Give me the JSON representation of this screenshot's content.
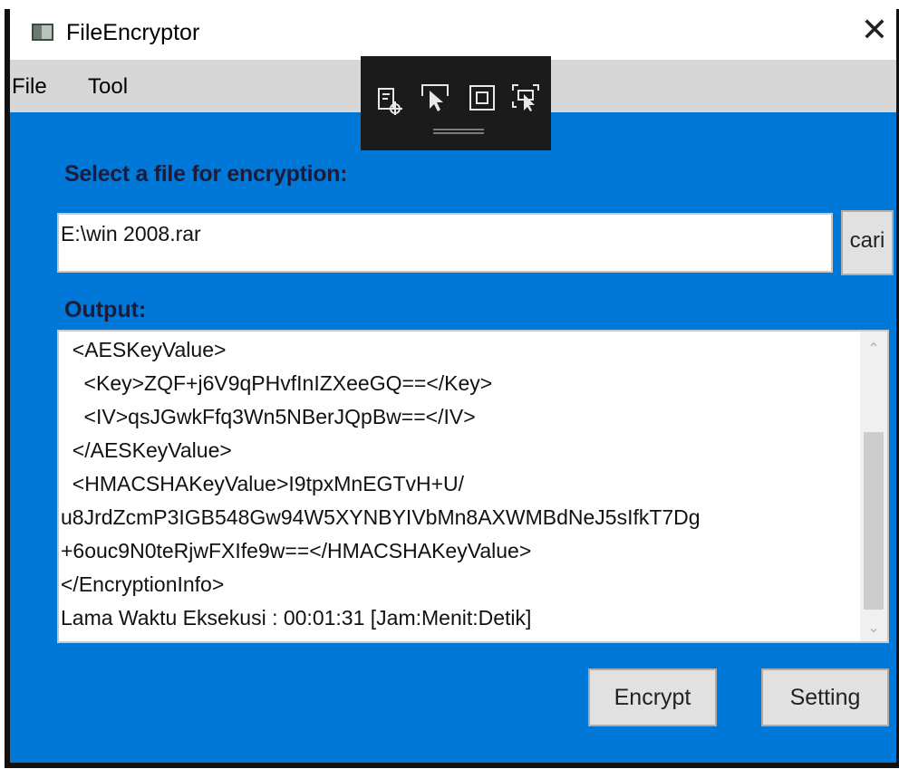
{
  "window": {
    "title": "FileEncryptor",
    "close_glyph": "✕"
  },
  "menu": {
    "items": [
      "File",
      "Tool"
    ]
  },
  "debug_toolbar": {
    "icons": [
      "select-element-icon",
      "pointer-icon",
      "frame-icon",
      "inspect-icon"
    ]
  },
  "form": {
    "select_label": "Select a file for encryption:",
    "file_path": "E:\\win 2008.rar",
    "browse_label": "cari",
    "output_label": "Output:",
    "output_lines": [
      "  <AESKeyValue>",
      "    <Key>ZQF+j6V9qPHvfInIZXeeGQ==</Key>",
      "    <IV>qsJGwkFfq3Wn5NBerJQpBw==</IV>",
      "  </AESKeyValue>",
      "  <HMACSHAKeyValue>I9tpxMnEGTvH+U/",
      "u8JrdZcmP3IGB548Gw94W5XYNBYIVbMn8AXWMBdNeJ5sIfkT7Dg",
      "+6ouc9N0teRjwFXIfe9w==</HMACSHAKeyValue>",
      "</EncryptionInfo>",
      "Lama Waktu Eksekusi : 00:01:31 [Jam:Menit:Detik]"
    ]
  },
  "buttons": {
    "encrypt": "Encrypt",
    "setting": "Setting"
  },
  "colors": {
    "accent": "#0078d7",
    "menubar": "#d7d7d7",
    "button": "#e1e1e1",
    "toolbar": "#1b1b1b"
  }
}
